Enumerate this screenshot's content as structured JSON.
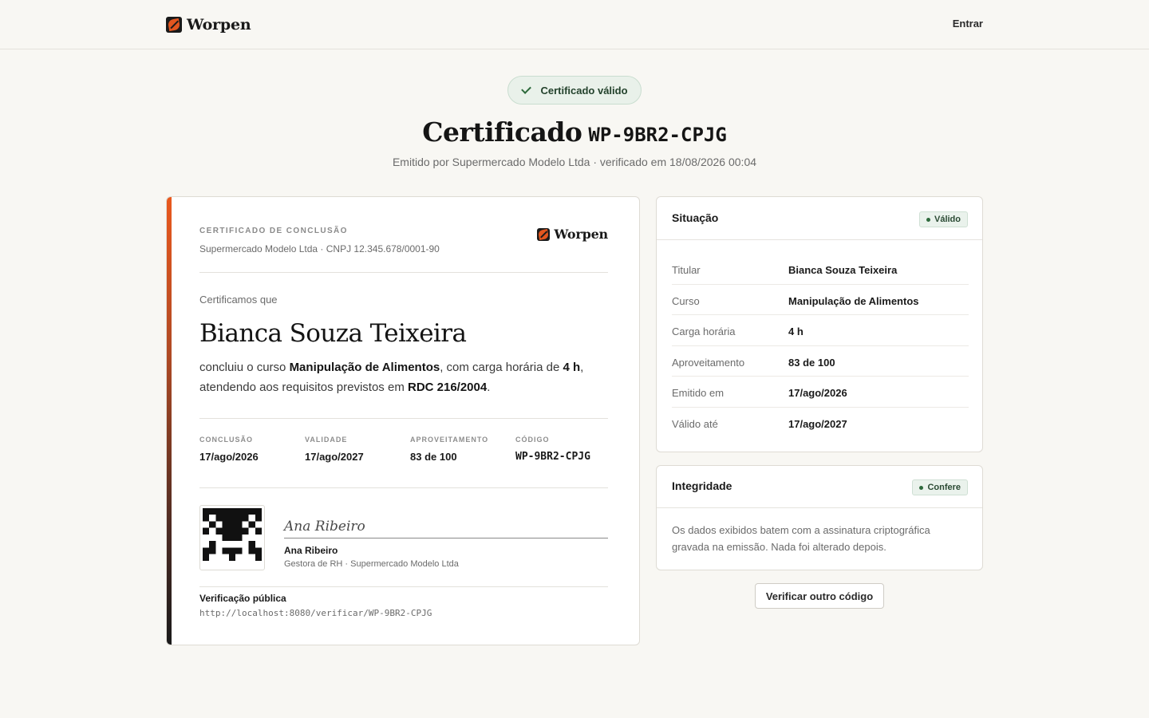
{
  "header": {
    "brand": "Worpen",
    "login_label": "Entrar"
  },
  "hero": {
    "status_label": "Certificado válido",
    "title_prefix": "Certificado",
    "title_code": "WP-9BR2-CPJG",
    "subtitle": "Emitido por Supermercado Modelo Ltda · verificado em 18/08/2026 00:04"
  },
  "certificate": {
    "eyebrow": "CERTIFICADO DE CONCLUSÃO",
    "issuer_line": "Supermercado Modelo Ltda · CNPJ 12.345.678/0001-90",
    "brand": "Worpen",
    "intro": "Certificamos que",
    "holder_name": "Bianca Souza Teixeira",
    "body": {
      "p1": "concluiu o curso ",
      "course": "Manipulação de Alimentos",
      "p2": ", com carga horária de ",
      "hours": "4 h",
      "p3": ",",
      "p4": "atendendo aos requisitos previstos em ",
      "norm": "RDC 216/2004",
      "p5": "."
    },
    "facts": [
      {
        "label": "CONCLUSÃO",
        "value": "17/ago/2026"
      },
      {
        "label": "VALIDADE",
        "value": "17/ago/2027"
      },
      {
        "label": "APROVEITAMENTO",
        "value": "83 de 100"
      },
      {
        "label": "CÓDIGO",
        "value": "WP-9BR2-CPJG"
      }
    ],
    "signature_script": "Ana Ribeiro",
    "signer_name": "Ana Ribeiro",
    "signer_role": "Gestora de RH · Supermercado Modelo Ltda",
    "verification_label": "Verificação pública",
    "verification_url": "http://localhost:8080/verificar/WP-9BR2-CPJG"
  },
  "status_panel": {
    "title": "Situação",
    "badge": "Válido",
    "rows": [
      {
        "label": "Titular",
        "value": "Bianca Souza Teixeira"
      },
      {
        "label": "Curso",
        "value": "Manipulação de Alimentos"
      },
      {
        "label": "Carga horária",
        "value": "4 h"
      },
      {
        "label": "Aproveitamento",
        "value": "83 de 100"
      },
      {
        "label": "Emitido em",
        "value": "17/ago/2026"
      },
      {
        "label": "Válido até",
        "value": "17/ago/2027"
      }
    ]
  },
  "integrity_panel": {
    "title": "Integridade",
    "badge": "Confere",
    "text": "Os dados exibidos batem com a assinatura criptográfica gravada na emissão. Nada foi alterado depois."
  },
  "actions": {
    "verify_other": "Verificar outro código"
  },
  "colors": {
    "accent": "#e9581d",
    "valid_green": "#2e6a3c",
    "background": "#f8f7f3"
  }
}
